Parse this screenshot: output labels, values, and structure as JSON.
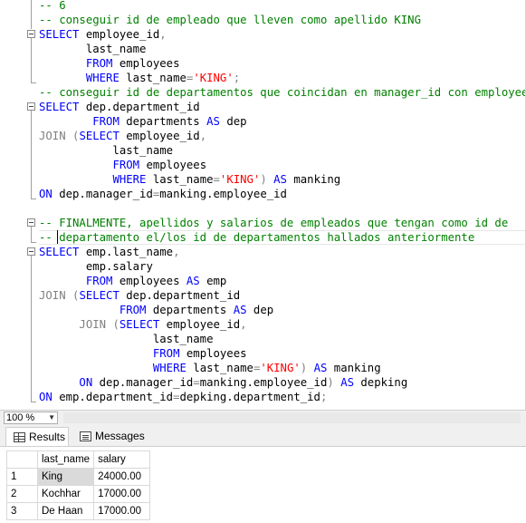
{
  "editor": {
    "lines": [
      [
        {
          "t": "-- 6",
          "c": "cm"
        }
      ],
      [
        {
          "t": "-- conseguir id de empleado que lleven como apellido KING",
          "c": "cm"
        }
      ],
      [
        {
          "t": "SELECT",
          "c": "kw"
        },
        {
          "t": " employee_id",
          "c": ""
        },
        {
          "t": ",",
          "c": "gy"
        }
      ],
      [
        {
          "t": "       last_name",
          "c": ""
        }
      ],
      [
        {
          "t": "       ",
          "c": ""
        },
        {
          "t": "FROM",
          "c": "kw"
        },
        {
          "t": " employees",
          "c": ""
        }
      ],
      [
        {
          "t": "       ",
          "c": ""
        },
        {
          "t": "WHERE",
          "c": "kw"
        },
        {
          "t": " last_name",
          "c": ""
        },
        {
          "t": "=",
          "c": "gy"
        },
        {
          "t": "'KING'",
          "c": "st"
        },
        {
          "t": ";",
          "c": "gy"
        }
      ],
      [
        {
          "t": "-- conseguir id de departamentos que coincidan en manager_id con employee_id",
          "c": "cm"
        }
      ],
      [
        {
          "t": "SELECT",
          "c": "kw"
        },
        {
          "t": " dep.department_id",
          "c": ""
        }
      ],
      [
        {
          "t": "        ",
          "c": ""
        },
        {
          "t": "FROM",
          "c": "kw"
        },
        {
          "t": " departments ",
          "c": ""
        },
        {
          "t": "AS",
          "c": "kw"
        },
        {
          "t": " dep",
          "c": ""
        }
      ],
      [
        {
          "t": "JOIN",
          "c": "gy"
        },
        {
          "t": " (",
          "c": "gy"
        },
        {
          "t": "SELECT",
          "c": "kw"
        },
        {
          "t": " employee_id",
          "c": ""
        },
        {
          "t": ",",
          "c": "gy"
        }
      ],
      [
        {
          "t": "           last_name",
          "c": ""
        }
      ],
      [
        {
          "t": "           ",
          "c": ""
        },
        {
          "t": "FROM",
          "c": "kw"
        },
        {
          "t": " employees",
          "c": ""
        }
      ],
      [
        {
          "t": "           ",
          "c": ""
        },
        {
          "t": "WHERE",
          "c": "kw"
        },
        {
          "t": " last_name",
          "c": ""
        },
        {
          "t": "=",
          "c": "gy"
        },
        {
          "t": "'KING'",
          "c": "st"
        },
        {
          "t": ") ",
          "c": "gy"
        },
        {
          "t": "AS",
          "c": "kw"
        },
        {
          "t": " manking",
          "c": ""
        }
      ],
      [
        {
          "t": "ON",
          "c": "kw"
        },
        {
          "t": " dep.manager_id",
          "c": ""
        },
        {
          "t": "=",
          "c": "gy"
        },
        {
          "t": "manking.employee_id",
          "c": ""
        }
      ],
      [
        {
          "t": "",
          "c": ""
        }
      ],
      [
        {
          "t": "-- FINALMENTE, apellidos y salarios de empleados que tengan como id de",
          "c": "cm"
        }
      ],
      [
        {
          "t": "-- departamento el/los id de departamentos hallados anteriormente",
          "c": "cm"
        }
      ],
      [
        {
          "t": "SELECT",
          "c": "kw"
        },
        {
          "t": " emp.last_name",
          "c": ""
        },
        {
          "t": ",",
          "c": "gy"
        }
      ],
      [
        {
          "t": "       emp.salary",
          "c": ""
        }
      ],
      [
        {
          "t": "       ",
          "c": ""
        },
        {
          "t": "FROM",
          "c": "kw"
        },
        {
          "t": " employees ",
          "c": ""
        },
        {
          "t": "AS",
          "c": "kw"
        },
        {
          "t": " emp",
          "c": ""
        }
      ],
      [
        {
          "t": "JOIN",
          "c": "gy"
        },
        {
          "t": " (",
          "c": "gy"
        },
        {
          "t": "SELECT",
          "c": "kw"
        },
        {
          "t": " dep.department_id",
          "c": ""
        }
      ],
      [
        {
          "t": "            ",
          "c": ""
        },
        {
          "t": "FROM",
          "c": "kw"
        },
        {
          "t": " departments ",
          "c": ""
        },
        {
          "t": "AS",
          "c": "kw"
        },
        {
          "t": " dep",
          "c": ""
        }
      ],
      [
        {
          "t": "      ",
          "c": ""
        },
        {
          "t": "JOIN",
          "c": "gy"
        },
        {
          "t": " (",
          "c": "gy"
        },
        {
          "t": "SELECT",
          "c": "kw"
        },
        {
          "t": " employee_id",
          "c": ""
        },
        {
          "t": ",",
          "c": "gy"
        }
      ],
      [
        {
          "t": "                 last_name",
          "c": ""
        }
      ],
      [
        {
          "t": "                 ",
          "c": ""
        },
        {
          "t": "FROM",
          "c": "kw"
        },
        {
          "t": " employees",
          "c": ""
        }
      ],
      [
        {
          "t": "                 ",
          "c": ""
        },
        {
          "t": "WHERE",
          "c": "kw"
        },
        {
          "t": " last_name",
          "c": ""
        },
        {
          "t": "=",
          "c": "gy"
        },
        {
          "t": "'KING'",
          "c": "st"
        },
        {
          "t": ") ",
          "c": "gy"
        },
        {
          "t": "AS",
          "c": "kw"
        },
        {
          "t": " manking",
          "c": ""
        }
      ],
      [
        {
          "t": "      ",
          "c": ""
        },
        {
          "t": "ON",
          "c": "kw"
        },
        {
          "t": " dep.manager_id",
          "c": ""
        },
        {
          "t": "=",
          "c": "gy"
        },
        {
          "t": "manking.employee_id",
          "c": ""
        },
        {
          "t": ") ",
          "c": "gy"
        },
        {
          "t": "AS",
          "c": "kw"
        },
        {
          "t": " depking",
          "c": ""
        }
      ],
      [
        {
          "t": "ON",
          "c": "kw"
        },
        {
          "t": " emp.department_id",
          "c": ""
        },
        {
          "t": "=",
          "c": "gy"
        },
        {
          "t": "depking.department_id",
          "c": ""
        },
        {
          "t": ";",
          "c": "gy"
        }
      ]
    ]
  },
  "statusbar": {
    "zoom": "100 %"
  },
  "tabs": {
    "results": "Results",
    "messages": "Messages"
  },
  "results": {
    "columns": [
      "last_name",
      "salary"
    ],
    "rows": [
      {
        "n": "1",
        "last_name": "King",
        "salary": "24000.00"
      },
      {
        "n": "2",
        "last_name": "Kochhar",
        "salary": "17000.00"
      },
      {
        "n": "3",
        "last_name": "De Haan",
        "salary": "17000.00"
      }
    ]
  },
  "colors": {
    "keyword": "#0000ff",
    "comment": "#008000",
    "string": "#ff0000",
    "operator": "#808080"
  }
}
